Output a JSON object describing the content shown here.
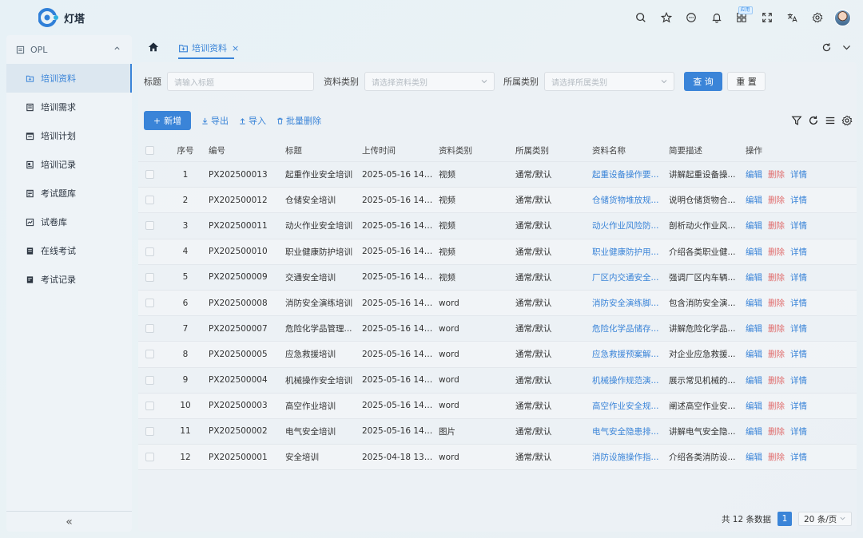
{
  "app": {
    "name": "灯塔"
  },
  "header": {
    "icons": [
      "search-icon",
      "star-icon",
      "message-icon",
      "bell-icon",
      "apps-icon",
      "fullscreen-icon",
      "translate-icon",
      "gear-icon"
    ],
    "app_badge": "应用"
  },
  "sidebar": {
    "group_label": "OPL",
    "items": [
      {
        "label": "培训资料",
        "icon": "file-plus-icon",
        "active": true
      },
      {
        "label": "培训需求",
        "icon": "doc-list-icon"
      },
      {
        "label": "培训计划",
        "icon": "calendar-list-icon"
      },
      {
        "label": "培训记录",
        "icon": "record-icon"
      },
      {
        "label": "考试题库",
        "icon": "question-bank-icon"
      },
      {
        "label": "试卷库",
        "icon": "chart-icon"
      },
      {
        "label": "在线考试",
        "icon": "exam-icon"
      },
      {
        "label": "考试记录",
        "icon": "exam-record-icon"
      }
    ],
    "collapse_label": "«"
  },
  "tabs": {
    "active_label": "培训资料",
    "close_label": "×"
  },
  "search": {
    "title_label": "标题",
    "title_placeholder": "请输入标题",
    "type_label": "资料类别",
    "type_placeholder": "请选择资料类别",
    "cat_label": "所属类别",
    "cat_placeholder": "请选择所属类别",
    "query_label": "查 询",
    "reset_label": "重 置"
  },
  "toolbar": {
    "add_label": "新增",
    "export_label": "导出",
    "import_label": "导入",
    "batch_delete_label": "批量删除"
  },
  "table": {
    "headers": {
      "idx": "序号",
      "code": "编号",
      "title": "标题",
      "time": "上传时间",
      "type": "资料类别",
      "cat": "所属类别",
      "name": "资料名称",
      "desc": "简要描述",
      "ops": "操作"
    },
    "op_edit": "编辑",
    "op_delete": "删除",
    "op_detail": "详情",
    "rows": [
      {
        "idx": "1",
        "code": "PX202500013",
        "title": "起重作业安全培训",
        "time": "2025-05-16 14:5...",
        "type": "视频",
        "cat": "通常/默认",
        "name": "起重设备操作要...",
        "desc": "讲解起重设备操..."
      },
      {
        "idx": "2",
        "code": "PX202500012",
        "title": "仓储安全培训",
        "time": "2025-05-16 14:5...",
        "type": "视频",
        "cat": "通常/默认",
        "name": "仓储货物堆放规...",
        "desc": "说明仓储货物合..."
      },
      {
        "idx": "3",
        "code": "PX202500011",
        "title": "动火作业安全培训",
        "time": "2025-05-16 14:4...",
        "type": "视频",
        "cat": "通常/默认",
        "name": "动火作业风险防...",
        "desc": "剖析动火作业风..."
      },
      {
        "idx": "4",
        "code": "PX202500010",
        "title": "职业健康防护培训",
        "time": "2025-05-16 14:4...",
        "type": "视频",
        "cat": "通常/默认",
        "name": "职业健康防护用...",
        "desc": "介绍各类职业健..."
      },
      {
        "idx": "5",
        "code": "PX202500009",
        "title": "交通安全培训",
        "time": "2025-05-16 14:4...",
        "type": "视频",
        "cat": "通常/默认",
        "name": "厂区内交通安全...",
        "desc": "强调厂区内车辆..."
      },
      {
        "idx": "6",
        "code": "PX202500008",
        "title": "消防安全演练培训",
        "time": "2025-05-16 14:4...",
        "type": "word",
        "cat": "通常/默认",
        "name": "消防安全演练脚...",
        "desc": "包含消防安全演..."
      },
      {
        "idx": "7",
        "code": "PX202500007",
        "title": "危险化学品管理...",
        "time": "2025-05-16 14:4...",
        "type": "word",
        "cat": "通常/默认",
        "name": "危险化学品储存...",
        "desc": "讲解危险化学品..."
      },
      {
        "idx": "8",
        "code": "PX202500005",
        "title": "应急救援培训",
        "time": "2025-05-16 14:3...",
        "type": "word",
        "cat": "通常/默认",
        "name": "应急救援预案解...",
        "desc": "对企业应急救援..."
      },
      {
        "idx": "9",
        "code": "PX202500004",
        "title": "机械操作安全培训",
        "time": "2025-05-16 14:2...",
        "type": "word",
        "cat": "通常/默认",
        "name": "机械操作规范演...",
        "desc": "展示常见机械的..."
      },
      {
        "idx": "10",
        "code": "PX202500003",
        "title": "高空作业培训",
        "time": "2025-05-16 14:2...",
        "type": "word",
        "cat": "通常/默认",
        "name": "高空作业安全规...",
        "desc": "阐述高空作业安..."
      },
      {
        "idx": "11",
        "code": "PX202500002",
        "title": "电气安全培训",
        "time": "2025-05-16 14:1...",
        "type": "图片",
        "cat": "通常/默认",
        "name": "电气安全隐患排...",
        "desc": "讲解电气安全隐..."
      },
      {
        "idx": "12",
        "code": "PX202500001",
        "title": "安全培训",
        "time": "2025-04-18 13:4...",
        "type": "word",
        "cat": "通常/默认",
        "name": "消防设施操作指...",
        "desc": "介绍各类消防设..."
      }
    ]
  },
  "pagination": {
    "total_text": "共 12 条数据",
    "current_page": "1",
    "page_size": "20 条/页"
  },
  "colors": {
    "primary": "#3a84d8",
    "danger": "#e06b6b"
  }
}
